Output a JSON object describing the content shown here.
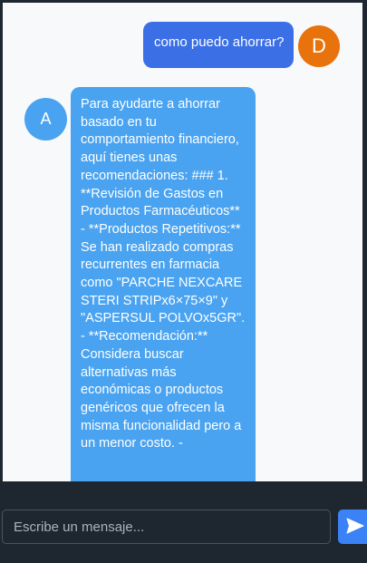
{
  "chat": {
    "user_message": {
      "text": "como puedo ahorrar?",
      "avatar_initial": "D",
      "avatar_color": "#e8720c",
      "bubble_color": "#3b6fe6"
    },
    "bot_message": {
      "avatar_initial": "A",
      "avatar_color": "#4aa3f0",
      "bubble_color": "#4aa3f0",
      "text": "Para ayudarte a ahorrar basado en tu comportamiento financiero, aquí tienes unas recomendaciones: ### 1. **Revisión de Gastos en Productos Farmacéuticos** - **Productos Repetitivos:** Se han realizado compras recurrentes en farmacia como \"PARCHE NEXCARE STERI STRIPx6×75×9\" y \"ASPERSUL POLVOx5GR\". - **Recomendación:** Considera buscar alternativas más económicas o productos genéricos que ofrecen la misma funcionalidad pero a un menor costo. -"
    }
  },
  "composer": {
    "placeholder": "Escribe un mensaje...",
    "value": "",
    "send_icon": "send-icon",
    "send_button_color": "#3b82f6"
  }
}
